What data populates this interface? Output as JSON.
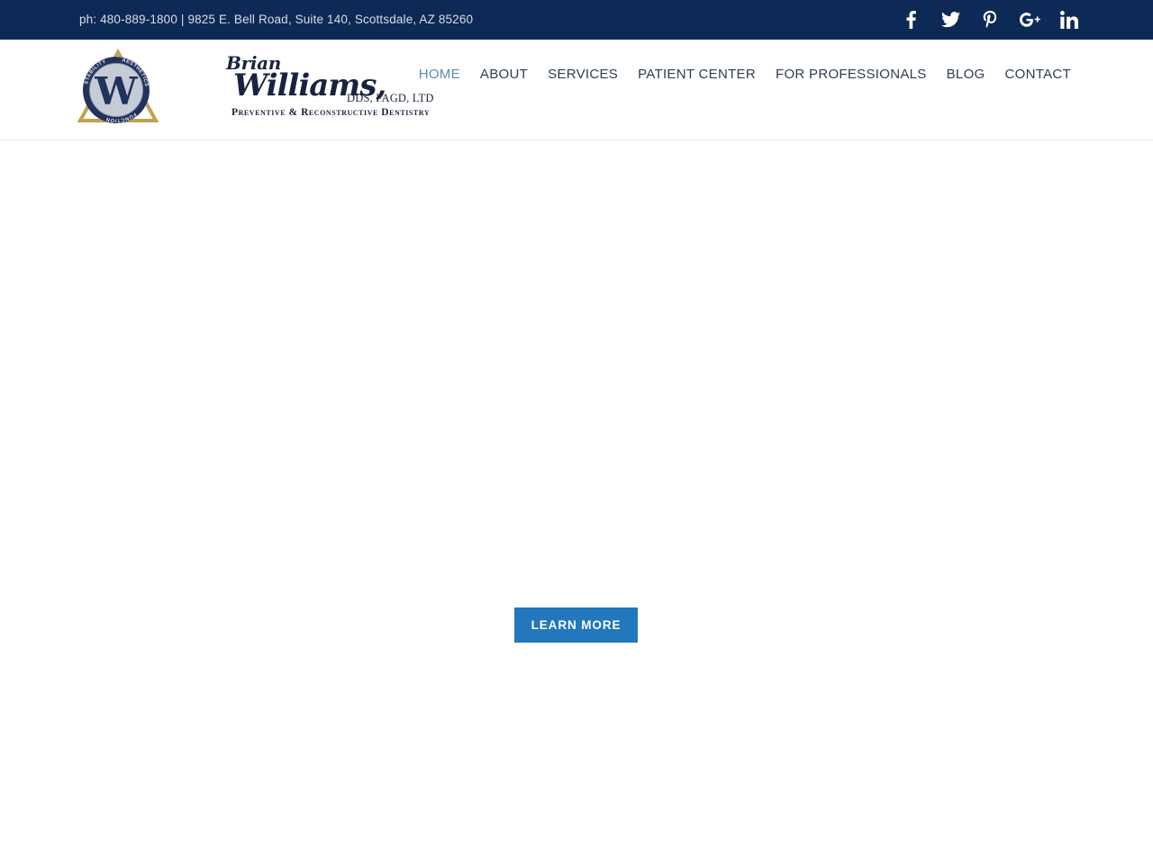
{
  "topbar": {
    "contact": "ph: 480-889-1800  |  9825 E. Bell Road, Suite 140, Scottsdale, AZ 85260",
    "background_color": "#0c2a55",
    "text_color": "#d9dde6",
    "social": [
      {
        "name": "facebook",
        "icon": "facebook-icon",
        "label": "Facebook"
      },
      {
        "name": "twitter",
        "icon": "twitter-icon",
        "label": "Twitter"
      },
      {
        "name": "pinterest",
        "icon": "pinterest-icon",
        "label": "Pinterest"
      },
      {
        "name": "googleplus",
        "icon": "google-plus-icon",
        "label": "Google Plus"
      },
      {
        "name": "linkedin",
        "icon": "linkedin-icon",
        "label": "LinkedIn"
      }
    ]
  },
  "header": {
    "logo": {
      "emblem_words": [
        "STABILITY",
        "AESTHETICS",
        "FUNCTION"
      ],
      "monogram": "W",
      "script_line_1": "Brian",
      "script_line_2": "Williams,",
      "credentials": "DDS, FAGD, LTD",
      "tagline": "Preventive & Reconstructive Dentistry",
      "colors": {
        "navy": "#18243f",
        "gold": "#c9a95c",
        "silver": "#c9ced6"
      }
    },
    "nav": [
      {
        "label": "HOME",
        "active": true
      },
      {
        "label": "ABOUT",
        "active": false
      },
      {
        "label": "SERVICES",
        "active": false
      },
      {
        "label": "PATIENT CENTER",
        "active": false
      },
      {
        "label": "FOR PROFESSIONALS",
        "active": false
      },
      {
        "label": "BLOG",
        "active": false
      },
      {
        "label": "CONTACT",
        "active": false
      }
    ],
    "nav_active_color": "#5b8fa8",
    "nav_color": "#2c3e50"
  },
  "main": {
    "cta_label": "LEARN MORE",
    "cta_color": "#2277bd",
    "cta_text_color": "#ffffff",
    "background_color": "#ffffff"
  }
}
